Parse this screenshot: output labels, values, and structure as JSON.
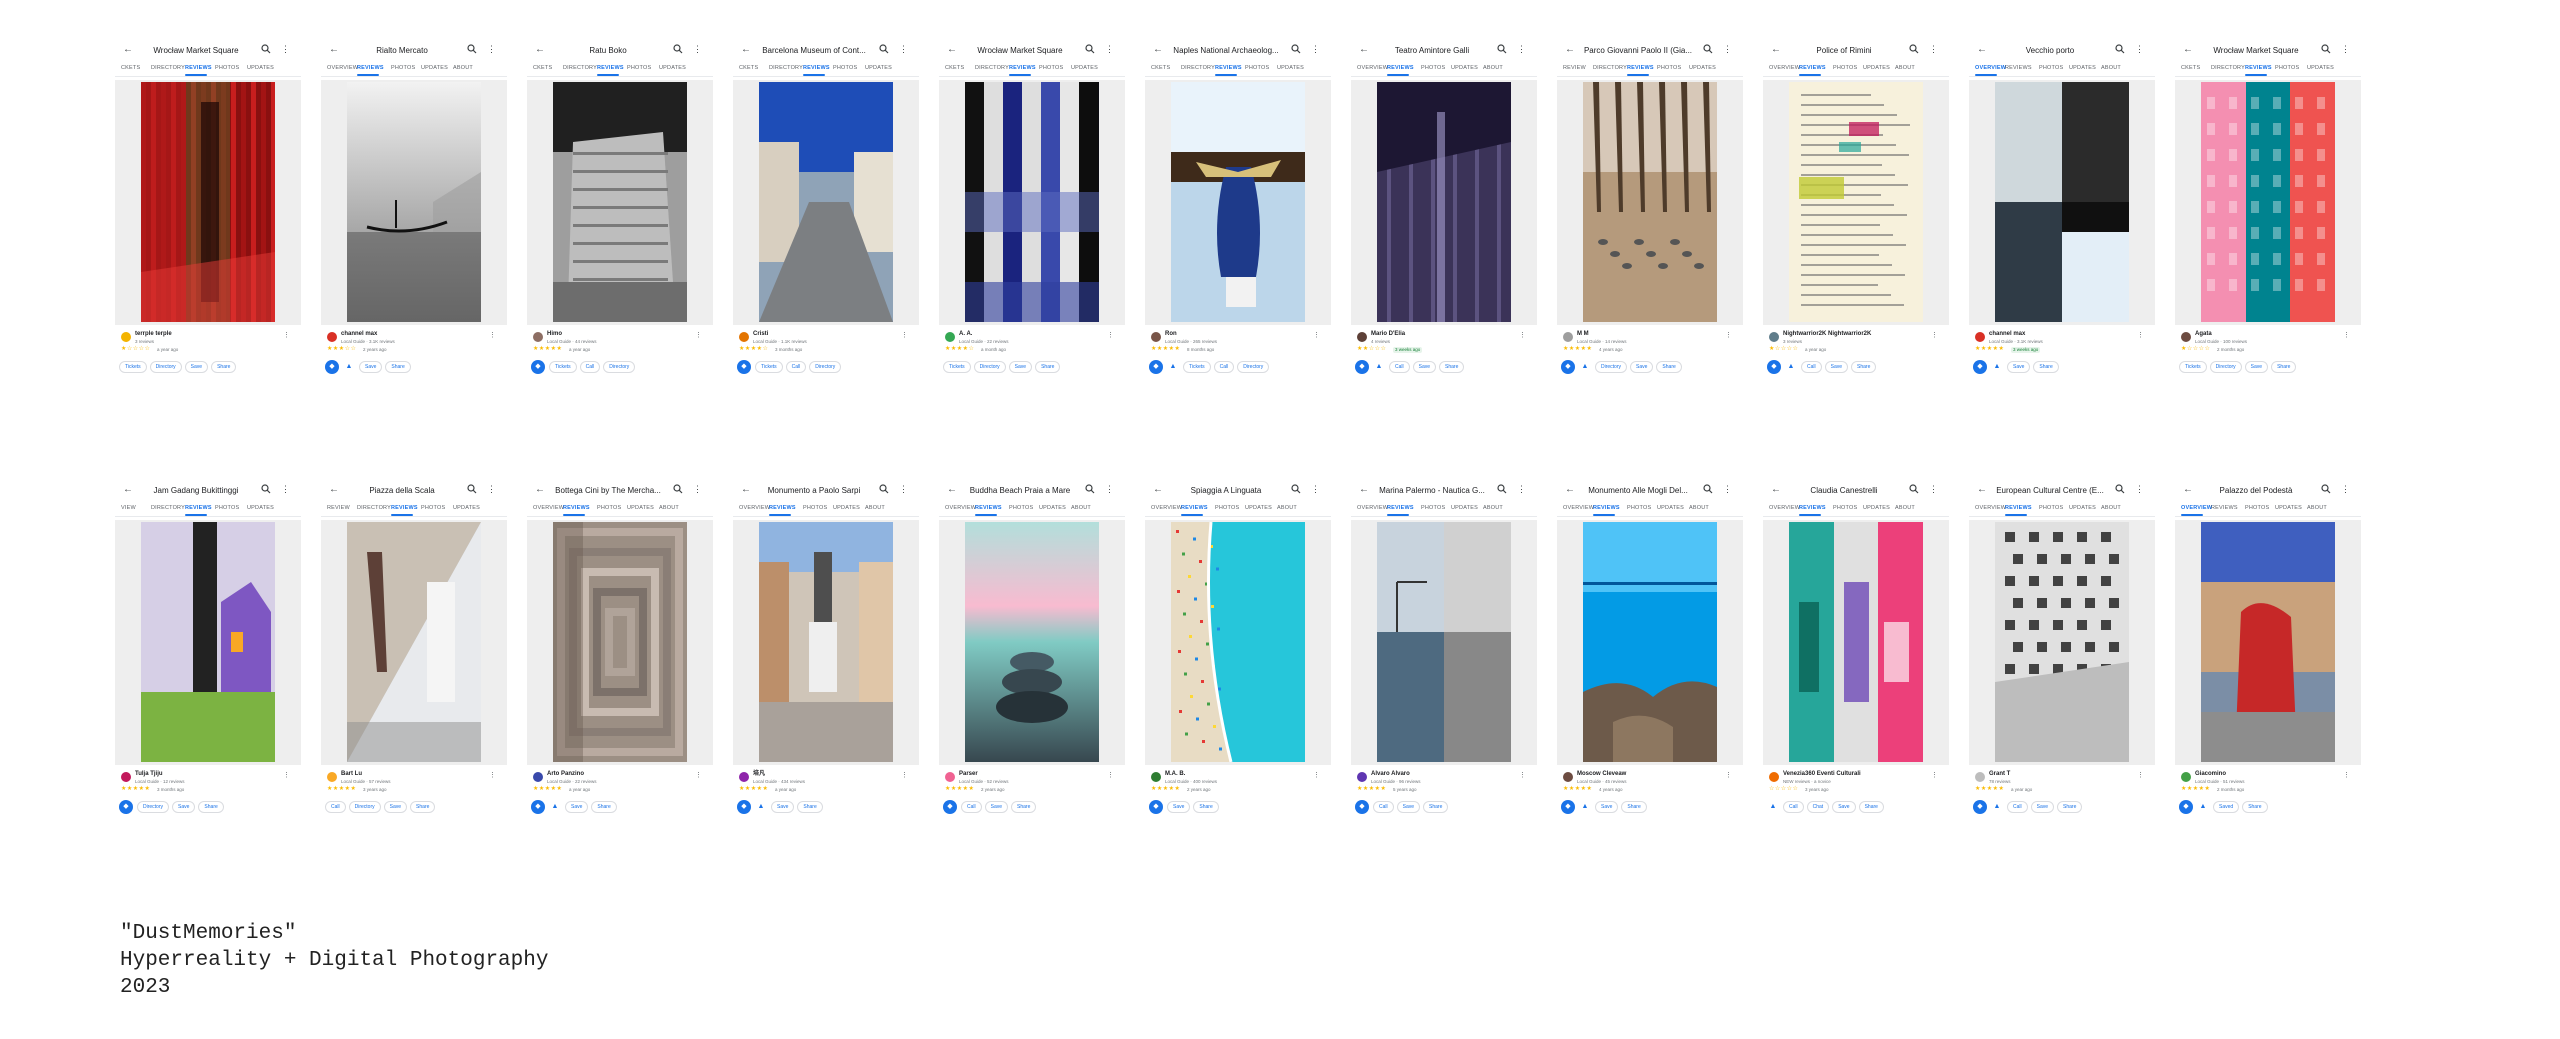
{
  "common": {
    "back_icon": "arrow-back-icon",
    "search_icon": "search-icon",
    "more_icon": "more-vert-icon",
    "directions_icon": "directions-icon",
    "navigate_icon": "navigate-icon",
    "star_color": "#fbbc04",
    "accent": "#1a73e8"
  },
  "panels": [
    {
      "title": "Wrocław Market Square",
      "tabs": [
        "CKETS",
        "DIRECTORY",
        "REVIEWS",
        "PHOTOS",
        "UPDATES"
      ],
      "active": 2,
      "photo": "red-market-strips",
      "avatar": "#f4b400",
      "name": "terrple terple",
      "sub": "3 reviews",
      "stars": 1,
      "date": "a year ago",
      "actions": {
        "fab": false,
        "nav": false,
        "chips": [
          "Tickets",
          "Directory",
          "Save",
          "Share"
        ]
      }
    },
    {
      "title": "Rialto Mercato",
      "tabs": [
        "OVERVIEW",
        "REVIEWS",
        "PHOTOS",
        "UPDATES",
        "ABOUT"
      ],
      "active": 1,
      "photo": "foggy-gondola",
      "avatar": "#d93025",
      "name": "channel max",
      "sub": "Local Guide · 3.1K reviews",
      "stars": 3,
      "date": "2 years ago",
      "actions": {
        "fab": true,
        "nav": true,
        "chips": [
          "Save",
          "Share"
        ]
      }
    },
    {
      "title": "Ratu Boko",
      "tabs": [
        "CKETS",
        "DIRECTORY",
        "REVIEWS",
        "PHOTOS",
        "UPDATES"
      ],
      "active": 2,
      "photo": "stone-temple",
      "avatar": "#8d6e63",
      "name": "Himo",
      "sub": "Local Guide · 44 reviews",
      "stars": 5,
      "date": "a year ago",
      "actions": {
        "fab": true,
        "nav": false,
        "chips": [
          "Tickets",
          "Call",
          "Directory"
        ]
      }
    },
    {
      "title": "Barcelona Museum of Cont...",
      "tabs": [
        "CKETS",
        "DIRECTORY",
        "REVIEWS",
        "PHOTOS",
        "UPDATES"
      ],
      "active": 2,
      "photo": "plaza-blue-sky",
      "avatar": "#e37400",
      "name": "Cristi",
      "sub": "Local Guide · 1.1K reviews",
      "stars": 4,
      "date": "3 months ago",
      "actions": {
        "fab": true,
        "nav": false,
        "chips": [
          "Tickets",
          "Call",
          "Directory"
        ]
      }
    },
    {
      "title": "Wrocław Market Square",
      "tabs": [
        "CKETS",
        "DIRECTORY",
        "REVIEWS",
        "PHOTOS",
        "UPDATES"
      ],
      "active": 2,
      "photo": "night-square-strips",
      "avatar": "#34a853",
      "name": "A. A.",
      "sub": "Local Guide · 22 reviews",
      "stars": 4,
      "date": "a month ago",
      "actions": {
        "fab": false,
        "nav": false,
        "chips": [
          "Tickets",
          "Directory",
          "Save",
          "Share"
        ]
      }
    },
    {
      "title": "Naples National Archaeolog...",
      "tabs": [
        "CKETS",
        "DIRECTORY",
        "REVIEWS",
        "PHOTOS",
        "UPDATES"
      ],
      "active": 2,
      "photo": "blue-statue",
      "avatar": "#795548",
      "name": "Ron",
      "sub": "Local Guide · 265 reviews",
      "stars": 5,
      "date": "8 months ago",
      "actions": {
        "fab": true,
        "nav": true,
        "chips": [
          "Tickets",
          "Call",
          "Directory"
        ]
      }
    },
    {
      "title": "Teatro Amintore Galli",
      "tabs": [
        "OVERVIEW",
        "REVIEWS",
        "PHOTOS",
        "UPDATES",
        "ABOUT"
      ],
      "active": 1,
      "photo": "purple-theatre",
      "avatar": "#5d4037",
      "name": "Mario D'Elia",
      "sub": "4 reviews",
      "stars": 2,
      "date": "3 weeks ago",
      "actions": {
        "fab": true,
        "nav": true,
        "chips": [
          "Call",
          "Save",
          "Share"
        ]
      }
    },
    {
      "title": "Parco Giovanni Paolo II (Gia...",
      "tabs": [
        "REVIEW",
        "DIRECTORY",
        "REVIEWS",
        "PHOTOS",
        "UPDATES"
      ],
      "active": 2,
      "photo": "park-pigeons",
      "avatar": "#9e9e9e",
      "name": "M M",
      "sub": "Local Guide · 14 reviews",
      "stars": 5,
      "date": "4 years ago",
      "actions": {
        "fab": true,
        "nav": true,
        "chips": [
          "Directory",
          "Save",
          "Share"
        ]
      }
    },
    {
      "title": "Police of Rimini",
      "tabs": [
        "OVERVIEW",
        "REVIEWS",
        "PHOTOS",
        "UPDATES",
        "ABOUT"
      ],
      "active": 1,
      "photo": "document-highlight",
      "avatar": "#607d8b",
      "name": "Nightwarrior2K Nightwarrior2K",
      "sub": "3 reviews",
      "stars": 1,
      "date": "a year ago",
      "actions": {
        "fab": true,
        "nav": true,
        "chips": [
          "Call",
          "Save",
          "Share"
        ]
      }
    },
    {
      "title": "Vecchio porto",
      "tabs": [
        "OVERVIEW",
        "REVIEWS",
        "PHOTOS",
        "UPDATES",
        "ABOUT"
      ],
      "active": 0,
      "photo": "harbor-split",
      "avatar": "#d93025",
      "name": "channel max",
      "sub": "Local Guide · 3.1K reviews",
      "stars": 5,
      "date": "3 weeks ago",
      "actions": {
        "fab": true,
        "nav": true,
        "chips": [
          "Save",
          "Share"
        ]
      }
    },
    {
      "title": "Wrocław Market Square",
      "tabs": [
        "CKETS",
        "DIRECTORY",
        "REVIEWS",
        "PHOTOS",
        "UPDATES"
      ],
      "active": 2,
      "photo": "pink-facades",
      "avatar": "#6d4c41",
      "name": "Agata",
      "sub": "Local Guide · 100 reviews",
      "stars": 1,
      "date": "2 months ago",
      "actions": {
        "fab": false,
        "nav": false,
        "chips": [
          "Tickets",
          "Directory",
          "Save",
          "Share"
        ]
      }
    },
    {
      "title": "Jam Gadang Bukittinggi",
      "tabs": [
        "VIEW",
        "DIRECTORY",
        "REVIEWS",
        "PHOTOS",
        "UPDATES"
      ],
      "active": 2,
      "photo": "clock-tower",
      "avatar": "#c2185b",
      "name": "Tulja Tjiju",
      "sub": "Local Guide · 12 reviews",
      "stars": 5,
      "date": "3 months ago",
      "actions": {
        "fab": true,
        "nav": false,
        "chips": [
          "Directory",
          "Save",
          "Share"
        ]
      }
    },
    {
      "title": "Piazza della Scala",
      "tabs": [
        "REVIEW",
        "DIRECTORY",
        "REVIEWS",
        "PHOTOS",
        "UPDATES"
      ],
      "active": 2,
      "photo": "diagonal-statue",
      "avatar": "#f9a825",
      "name": "Bart Lu",
      "sub": "Local Guide · 57 reviews",
      "stars": 5,
      "date": "3 years ago",
      "actions": {
        "fab": false,
        "nav": false,
        "chips": [
          "Call",
          "Directory",
          "Save",
          "Share"
        ]
      }
    },
    {
      "title": "Bottega Cini by The Mercha...",
      "tabs": [
        "OVERVIEW",
        "REVIEWS",
        "PHOTOS",
        "UPDATES",
        "ABOUT"
      ],
      "active": 1,
      "photo": "nested-frames",
      "avatar": "#3949ab",
      "name": "Arto Panzino",
      "sub": "Local Guide · 22 reviews",
      "stars": 5,
      "date": "a year ago",
      "actions": {
        "fab": true,
        "nav": true,
        "chips": [
          "Save",
          "Share"
        ]
      }
    },
    {
      "title": "Monumento a Paolo Sarpi",
      "tabs": [
        "OVERVIEW",
        "REVIEWS",
        "PHOTOS",
        "UPDATES",
        "ABOUT"
      ],
      "active": 1,
      "photo": "monument-street",
      "avatar": "#8e24aa",
      "name": "培凡",
      "sub": "Local Guide · 434 reviews",
      "stars": 5,
      "date": "a year ago",
      "actions": {
        "fab": true,
        "nav": true,
        "chips": [
          "Save",
          "Share"
        ]
      }
    },
    {
      "title": "Buddha Beach Praia a Mare",
      "tabs": [
        "OVERVIEW",
        "REVIEWS",
        "PHOTOS",
        "UPDATES",
        "ABOUT"
      ],
      "active": 1,
      "photo": "stone-stack",
      "avatar": "#f06292",
      "name": "Parser",
      "sub": "Local Guide · 52 reviews",
      "stars": 5,
      "date": "2 years ago",
      "actions": {
        "fab": true,
        "nav": false,
        "chips": [
          "Call",
          "Save",
          "Share"
        ]
      }
    },
    {
      "title": "Spiaggia A Linguata",
      "tabs": [
        "OVERVIEW",
        "REVIEWS",
        "PHOTOS",
        "UPDATES",
        "ABOUT"
      ],
      "active": 1,
      "photo": "aerial-beach",
      "avatar": "#2e7d32",
      "name": "M.A. B.",
      "sub": "Local Guide · 400 reviews",
      "stars": 5,
      "date": "2 years ago",
      "actions": {
        "fab": true,
        "nav": false,
        "chips": [
          "Save",
          "Share"
        ]
      }
    },
    {
      "title": "Marina Palermo - Nautica G...",
      "tabs": [
        "OVERVIEW",
        "REVIEWS",
        "PHOTOS",
        "UPDATES",
        "ABOUT"
      ],
      "active": 1,
      "photo": "port-cranes",
      "avatar": "#5e35b1",
      "name": "Alvaro Alvaro",
      "sub": "Local Guide · 96 reviews",
      "stars": 5,
      "date": "5 years ago",
      "actions": {
        "fab": true,
        "nav": false,
        "chips": [
          "Call",
          "Save",
          "Share"
        ]
      }
    },
    {
      "title": "Monumento Alle Mogli Del...",
      "tabs": [
        "OVERVIEW",
        "REVIEWS",
        "PHOTOS",
        "UPDATES",
        "ABOUT"
      ],
      "active": 1,
      "photo": "sea-rocks",
      "avatar": "#6d4c41",
      "name": "Moscow Cleveaw",
      "sub": "Local Guide · 45 reviews",
      "stars": 5,
      "date": "4 years ago",
      "actions": {
        "fab": true,
        "nav": true,
        "chips": [
          "Save",
          "Share"
        ]
      }
    },
    {
      "title": "Claudia Canestrelli",
      "tabs": [
        "OVERVIEW",
        "REVIEWS",
        "PHOTOS",
        "UPDATES",
        "ABOUT"
      ],
      "active": 1,
      "photo": "collage-statue",
      "avatar": "#ef6c00",
      "name": "Venezia360 Eventi Culturali",
      "sub": "NEW reviews · a novice",
      "stars": 0,
      "date": "3 years ago",
      "actions": {
        "fab": false,
        "nav": true,
        "chips": [
          "Call",
          "Chat",
          "Save",
          "Share"
        ]
      }
    },
    {
      "title": "European Cultural Centre (E...",
      "tabs": [
        "OVERVIEW",
        "REVIEWS",
        "PHOTOS",
        "UPDATES",
        "ABOUT"
      ],
      "active": 1,
      "photo": "white-building",
      "avatar": "#bdbdbd",
      "name": "Grant T",
      "sub": "78 reviews",
      "stars": 5,
      "date": "a year ago",
      "actions": {
        "fab": true,
        "nav": true,
        "chips": [
          "Call",
          "Save",
          "Share"
        ]
      }
    },
    {
      "title": "Palazzo del Podestà",
      "tabs": [
        "OVERVIEW",
        "REVIEWS",
        "PHOTOS",
        "UPDATES",
        "ABOUT"
      ],
      "active": 0,
      "photo": "red-costume-parade",
      "avatar": "#43a047",
      "name": "Giacomino",
      "sub": "Local Guide · 51 reviews",
      "stars": 5,
      "date": "2 months ago",
      "actions": {
        "fab": true,
        "nav": true,
        "chips": [
          "Saved",
          "Share"
        ]
      }
    }
  ],
  "caption": {
    "line1": "\"DustMemories\"",
    "line2": "Hyperreality + Digital Photography",
    "line3": "2023"
  }
}
